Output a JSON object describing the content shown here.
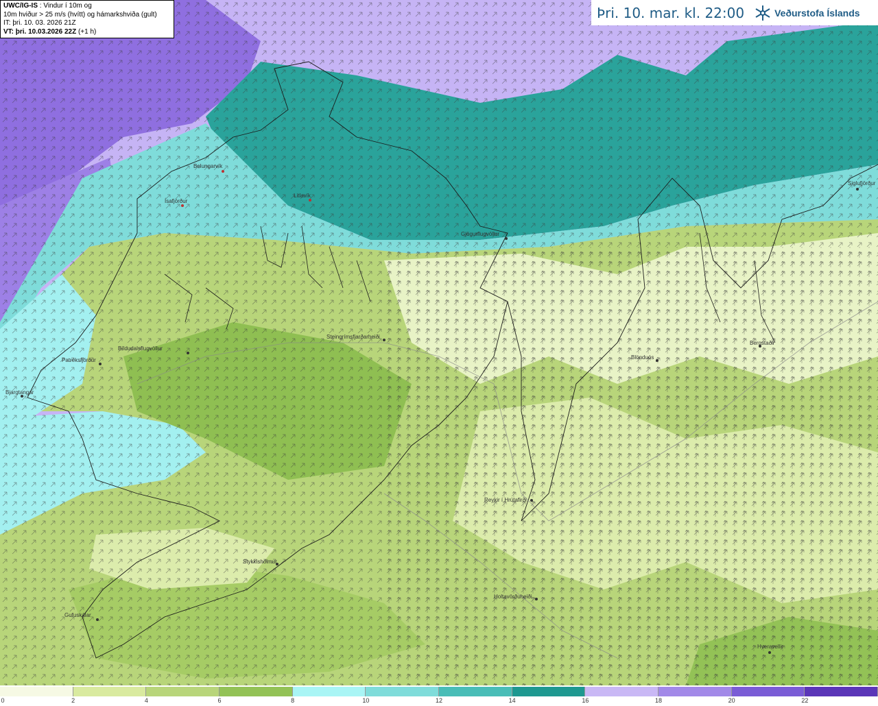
{
  "info": {
    "model": "UWC/IG-IS",
    "desc1": " : Vindur í 10m og",
    "desc2": "10m hviður > 25 m/s (hvítt) og hámarkshviða (gult)",
    "it": "IT: þri. 10. 03. 2026 21Z",
    "vt_label": "VT: þri. 10.03.2026 22Z",
    "vt_offset": " (+1 h)"
  },
  "header": {
    "time": "Þri. 10. mar. kl. 22:00",
    "logo_text": "Veðurstofa Íslands",
    "logo_icon": "snowflake-logo-icon"
  },
  "places": [
    {
      "name": "Bolungarvík"
    },
    {
      "name": "Ísafjörður"
    },
    {
      "name": "Litlavík"
    },
    {
      "name": "Gjögurflugvöllur"
    },
    {
      "name": "Siglufjörður"
    },
    {
      "name": "Patreksfjörður"
    },
    {
      "name": "Bíldudalsflugvöllur"
    },
    {
      "name": "Steingrímsfjarðarheiði"
    },
    {
      "name": "Blönduós"
    },
    {
      "name": "Bergstaðir"
    },
    {
      "name": "Bjargtangar"
    },
    {
      "name": "Reykir í Hrútafirði"
    },
    {
      "name": "Stykkishólmur"
    },
    {
      "name": "Holtavörðuheiði"
    },
    {
      "name": "Gufuskálar"
    },
    {
      "name": "Hveravellir"
    }
  ],
  "legend": {
    "ticks": [
      "0",
      "2",
      "4",
      "6",
      "8",
      "10",
      "12",
      "14",
      "16",
      "18",
      "20",
      "22"
    ],
    "colors": [
      "#f6f9e4",
      "#d9ea9f",
      "#b8d57a",
      "#93c256",
      "#a9f5f5",
      "#7fdcda",
      "#49bdb7",
      "#1e9890",
      "#c9b8f5",
      "#a289e8",
      "#7a5cd6",
      "#5b36b8"
    ]
  },
  "colors": {
    "sea_north": "#c6b4f5",
    "sea_deep": "#8f6fe0",
    "sea_teal": "#2aa39b",
    "sea_cyan": "#a3f0f0",
    "land_light": "#eef6cf",
    "land_mid": "#c5df8a",
    "land_dark": "#8fbf52"
  }
}
